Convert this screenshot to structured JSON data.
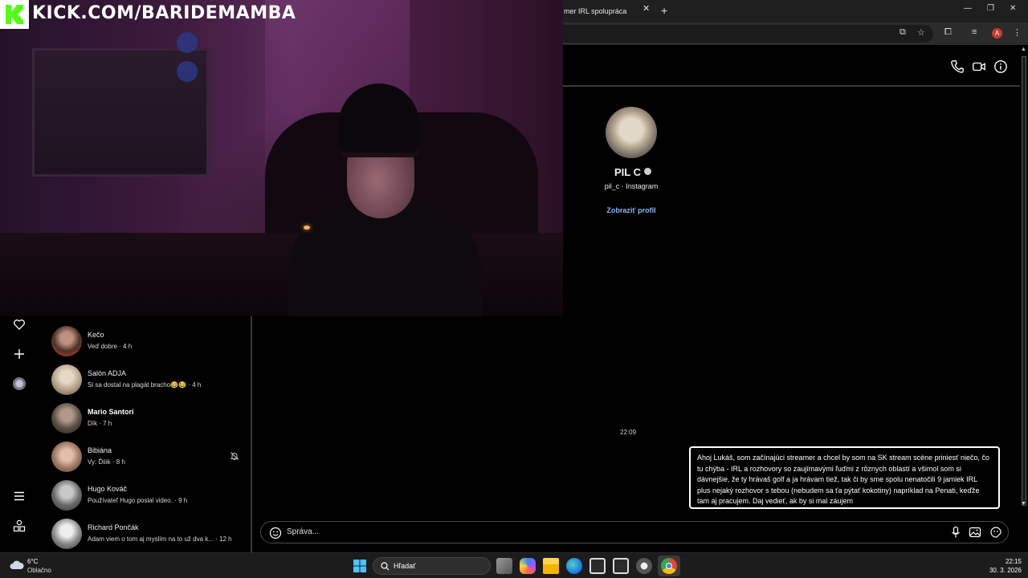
{
  "overlay": {
    "kick_url": "KICK.COM/BARIDEMAMBA",
    "kick_logo_letter": "K"
  },
  "browser": {
    "tab_title": "mer IRL spolupráca",
    "profile_initial": "A"
  },
  "chat": {
    "profile": {
      "name": "PIL C",
      "subtitle": "pil_c · Instagram",
      "view_profile": "Zobraziť profil"
    },
    "timestamp": "22:09",
    "message": "Ahoj Lukáš, som začínajúci streamer a chcel by som na SK stream scéne priniesť niečo, čo tu chýba - IRL a rozhovory so zaujímavými ľuďmi z rôznych oblastí a všimol som si dávnejšie, že ty hrávaš golf a ja hrávam tiež, tak či by sme spolu nenatočili 9 jamiek IRL plus nejaký rozhovor s tebou (nebudem sa ťa pýtať kokotiny) napríklad na Penati, keďže tam aj pracujem. Daj vedieť, ak by si mal záujem",
    "composer_placeholder": "Správa..."
  },
  "conversations": [
    {
      "name": "Kečo",
      "preview": "Veď dobre · 4 h",
      "unread": false,
      "avatar_color": "#6b4a3a"
    },
    {
      "name": "Salón ADJA",
      "preview": "Si sa dostal na plagát bracho😂😂 · 4 h",
      "unread": false,
      "avatar_color": "#9a8a6a"
    },
    {
      "name": "Mario Santori",
      "preview": "Dík · 7 h",
      "unread": true,
      "avatar_color": "#5a4e44"
    },
    {
      "name": "Bibiána",
      "preview": "Vy: Ďiiik · 8 h",
      "unread": false,
      "avatar_color": "#a07a66"
    },
    {
      "name": "Hugo Kováč",
      "preview": "Používateľ Hugo poslal video. · 9 h",
      "unread": false,
      "avatar_color": "#6a6a6a"
    },
    {
      "name": "Richard Pončák",
      "preview": "Adam viem o tom aj myslím na to už dva k... · 12 h",
      "unread": false,
      "avatar_color": "#8a8a8a"
    }
  ],
  "taskbar": {
    "temperature": "6°C",
    "condition": "Oblačno",
    "search_label": "Hľadať",
    "time": "22:15",
    "date": "30. 3. 2026"
  },
  "colors": {
    "link": "#8ab4f8",
    "kick_green": "#53fc18",
    "bubble_border": "#ffffff"
  }
}
